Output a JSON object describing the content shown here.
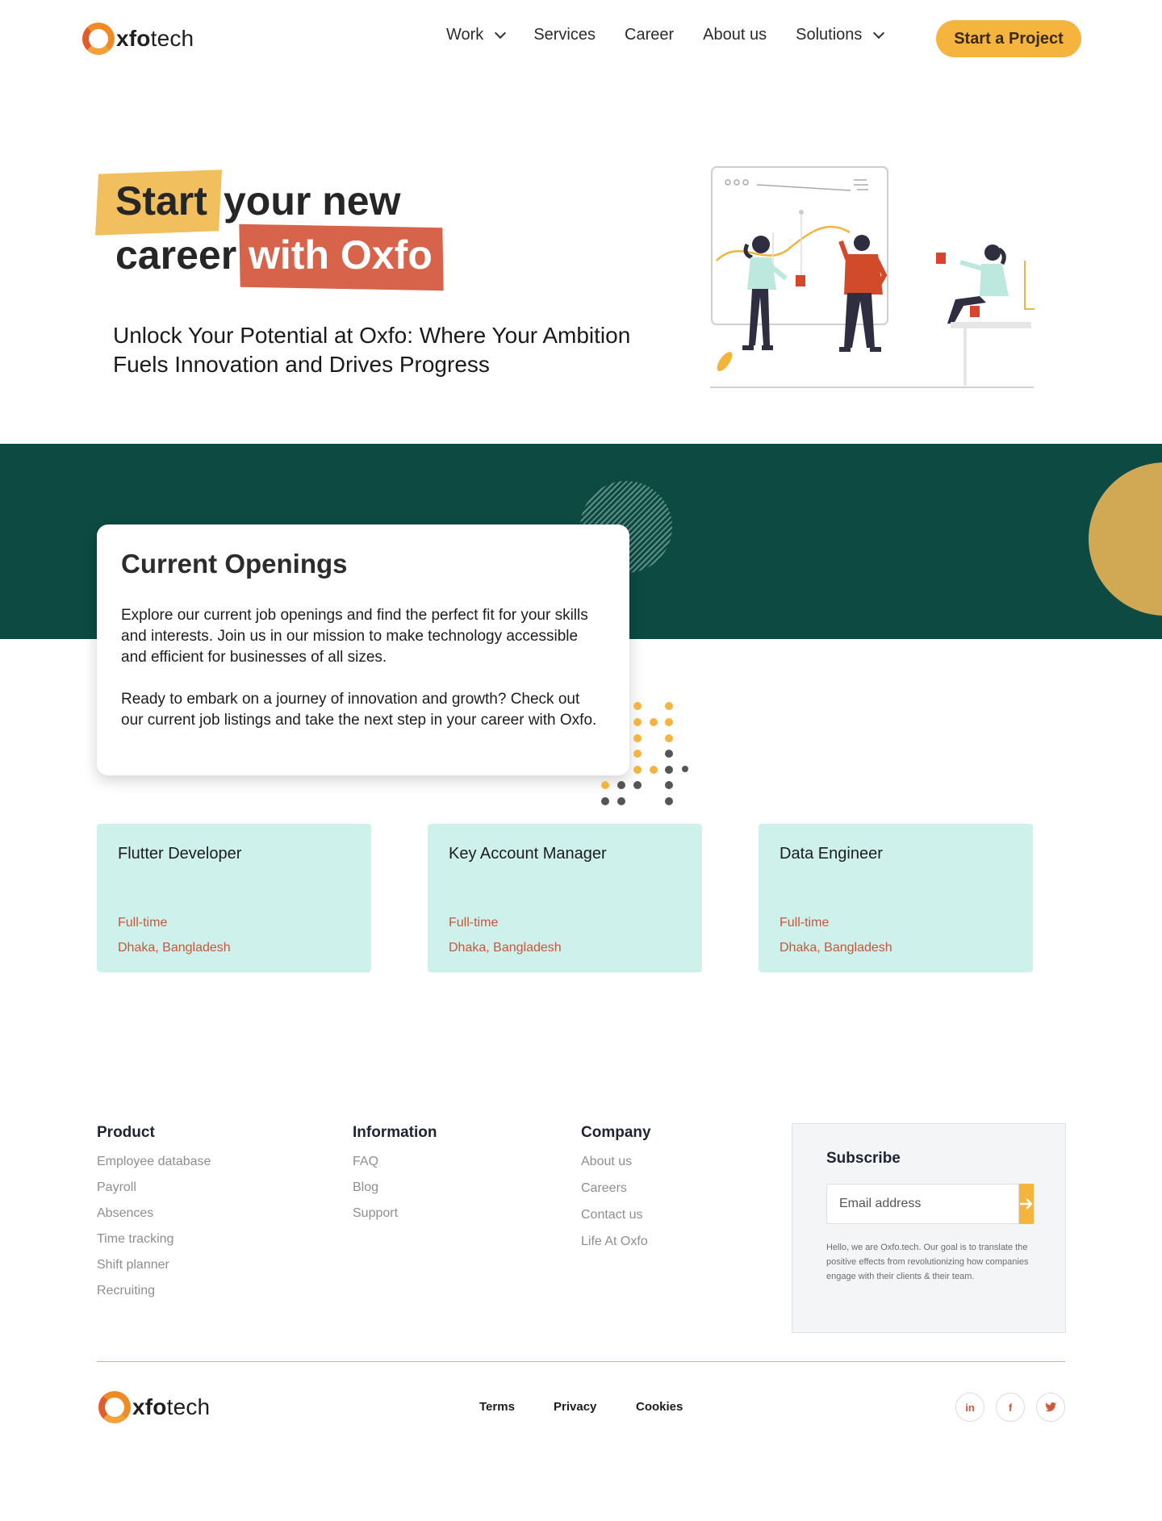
{
  "brand": {
    "name_bold": "xfo",
    "name_rest": "tech"
  },
  "nav": {
    "items": [
      {
        "label": "Work",
        "dropdown": true
      },
      {
        "label": "Services",
        "dropdown": false
      },
      {
        "label": "Career",
        "dropdown": false
      },
      {
        "label": "About us",
        "dropdown": false
      },
      {
        "label": "Solutions",
        "dropdown": true
      }
    ],
    "cta": "Start a  Project"
  },
  "hero": {
    "title_start": "Start",
    "title_mid": "your new",
    "title_career": "career",
    "title_highlight": "with Oxfo",
    "subtitle": "Unlock Your Potential at Oxfo: Where Your Ambition Fuels Innovation and Drives Progress"
  },
  "openings": {
    "heading": "Current Openings",
    "paragraph1": "Explore our current job openings and find the perfect fit for your skills and interests. Join us in our mission to make technology accessible and efficient for businesses of all sizes.",
    "paragraph2": "Ready to embark on a journey of innovation and growth? Check out our current job listings and take the next step in your career with Oxfo."
  },
  "jobs": [
    {
      "title": "Flutter Developer",
      "type": "Full-time",
      "location": "Dhaka, Bangladesh"
    },
    {
      "title": "Key Account Manager",
      "type": "Full-time",
      "location": "Dhaka, Bangladesh"
    },
    {
      "title": "Data Engineer",
      "type": "Full-time",
      "location": "Dhaka, Bangladesh"
    }
  ],
  "footer": {
    "product": {
      "heading": "Product",
      "links": [
        "Employee database",
        "Payroll",
        "Absences",
        "Time tracking",
        "Shift planner",
        "Recruiting"
      ]
    },
    "information": {
      "heading": "Information",
      "links": [
        "FAQ",
        "Blog",
        "Support"
      ]
    },
    "company": {
      "heading": "Company",
      "links": [
        "About us",
        "Careers",
        "Contact us",
        "Life At Oxfo"
      ]
    },
    "subscribe": {
      "heading": "Subscribe",
      "placeholder": "Email address",
      "button_icon": "arrow-right-icon",
      "text": "Hello, we are Oxfo.tech. Our goal is to translate the positive effects from revolutionizing how companies engage with their clients & their team."
    },
    "legal": [
      "Terms",
      "Privacy",
      "Cookies"
    ],
    "social": [
      {
        "icon": "linkedin-icon",
        "glyph": "in"
      },
      {
        "icon": "facebook-icon",
        "glyph": "f"
      },
      {
        "icon": "twitter-icon",
        "glyph": "t"
      }
    ]
  },
  "colors": {
    "accent": "#f5b43e",
    "brand_red": "#d7644a",
    "band": "#0c4a42",
    "job_card": "#cff1eb",
    "job_meta": "#c9563b"
  }
}
